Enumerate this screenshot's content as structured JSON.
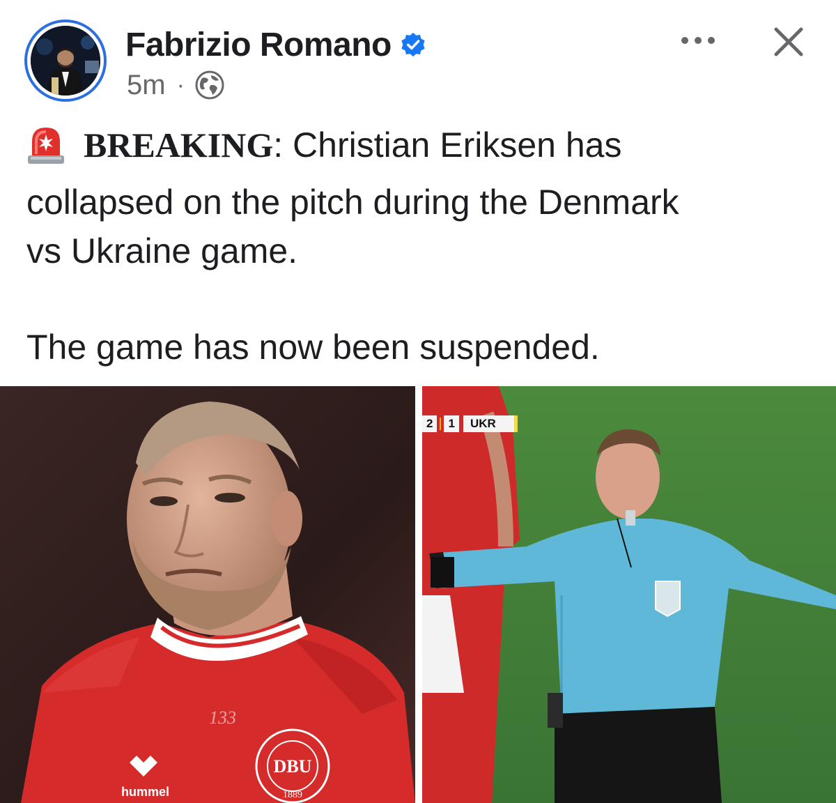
{
  "post": {
    "author": "Fabrizio Romano",
    "verified": true,
    "timestamp": "5m",
    "separator": "·",
    "audience_icon": "globe-icon",
    "more_icon": "more-options-icon",
    "close_icon": "close-icon",
    "alert_icon": "siren-emoji-icon",
    "breaking_label": "BREAKING",
    "line1_rest": ": Christian Eriksen has",
    "line2": "collapsed on the pitch during the Denmark",
    "line3": "vs Ukraine game.",
    "line4": "The game has now been suspended."
  },
  "images": {
    "left_jersey_text": "hummel",
    "left_badge_text": "DBU",
    "left_badge_year": "1889",
    "left_number": "133",
    "score_home": "2",
    "score_away": "1",
    "score_team": "UKR"
  },
  "colors": {
    "accent_blue": "#2d6fe0",
    "verified_blue": "#1877f2",
    "text_primary": "#1c1e21",
    "text_secondary": "#65676b",
    "denmark_red": "#d52b2b",
    "referee_shirt": "#5fb8d8",
    "pitch_green": "#3f7c37"
  }
}
